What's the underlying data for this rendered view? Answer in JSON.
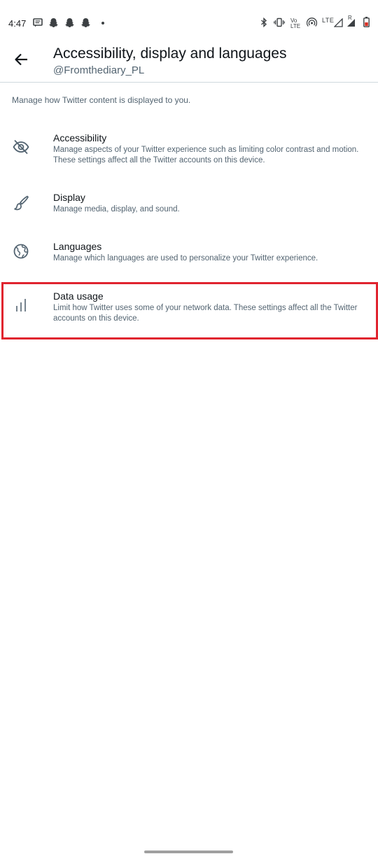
{
  "status_bar": {
    "time": "4:47",
    "notification_icons": [
      "message-icon",
      "snapchat-icon",
      "snapchat-icon",
      "snapchat-icon"
    ],
    "right_icons": [
      "bluetooth-icon",
      "vibrate-icon",
      "volte-icon",
      "hotspot-icon",
      "lte-signal-icon",
      "signal-icon",
      "battery-icon"
    ],
    "volte_label_top": "Vo ",
    "volte_label_bottom": "LTE",
    "lte_label": "LTE",
    "roaming_label": "R",
    "battery_color": "#d93025"
  },
  "header": {
    "title": "Accessibility, display and languages",
    "subtitle": "@Fromthediary_PL"
  },
  "intro": "Manage how Twitter content is displayed to you.",
  "items": [
    {
      "icon": "eye-slash-icon",
      "title": "Accessibility",
      "description": "Manage aspects of your Twitter experience such as limiting color contrast and motion. These settings affect all the Twitter accounts on this device."
    },
    {
      "icon": "paintbrush-icon",
      "title": "Display",
      "description": "Manage media, display, and sound."
    },
    {
      "icon": "globe-icon",
      "title": "Languages",
      "description": "Manage which languages are used to personalize your Twitter experience."
    },
    {
      "icon": "data-usage-icon",
      "title": "Data usage",
      "description": "Limit how Twitter uses some of your network data. These settings affect all the Twitter accounts on this device."
    }
  ],
  "colors": {
    "text_primary": "#0f1419",
    "text_secondary": "#536471",
    "divider": "#cfd9de",
    "highlight": "#e0242f"
  }
}
